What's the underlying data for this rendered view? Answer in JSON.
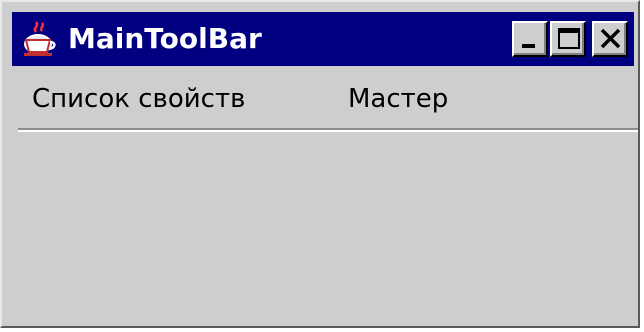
{
  "window": {
    "title": "MainToolBar",
    "title_bar_color": "#000080",
    "background_color": "#cecece",
    "controls": {
      "minimize_icon": "minimize-icon",
      "maximize_icon": "maximize-icon",
      "close_icon": "close-icon"
    }
  },
  "menu": {
    "items": [
      {
        "label": "Список свойств"
      },
      {
        "label": "Мастер"
      }
    ]
  }
}
